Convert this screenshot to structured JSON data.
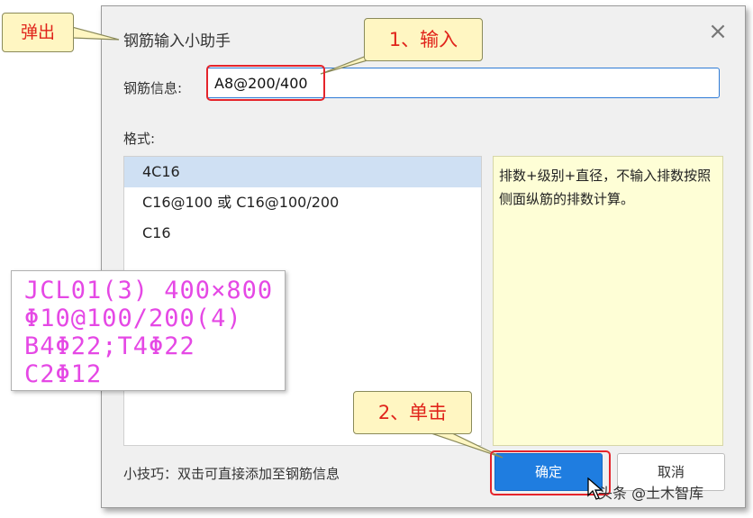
{
  "dialog": {
    "title": "钢筋输入小助手",
    "info_label": "钢筋信息:",
    "info_value": "A8@200/400",
    "format_label": "格式:",
    "formats": [
      "4C16",
      "C16@100 或 C16@100/200",
      "C16"
    ],
    "description": "排数+级别+直径，不输入排数按照侧面纵筋的排数计算。",
    "tip": "小技巧：双击可直接添加至钢筋信息",
    "ok_label": "确定",
    "cancel_label": "取消",
    "close_icon": "×"
  },
  "annotations": {
    "popup": "弹出",
    "step1": "1、输入",
    "step2": "2、单击"
  },
  "cad_text": {
    "line1": "JCL01(3) 400×800",
    "line2": "Φ10@100/200(4)",
    "line3": "B4Φ22;T4Φ22",
    "line4": "C2Φ12"
  },
  "watermark": "头条 @土木智库",
  "colors": {
    "accent": "#1f7de0",
    "callout_text": "#e0241b",
    "highlight_box": "#e5242b",
    "cad_text": "#e548e5",
    "desc_bg": "#fefed6"
  }
}
